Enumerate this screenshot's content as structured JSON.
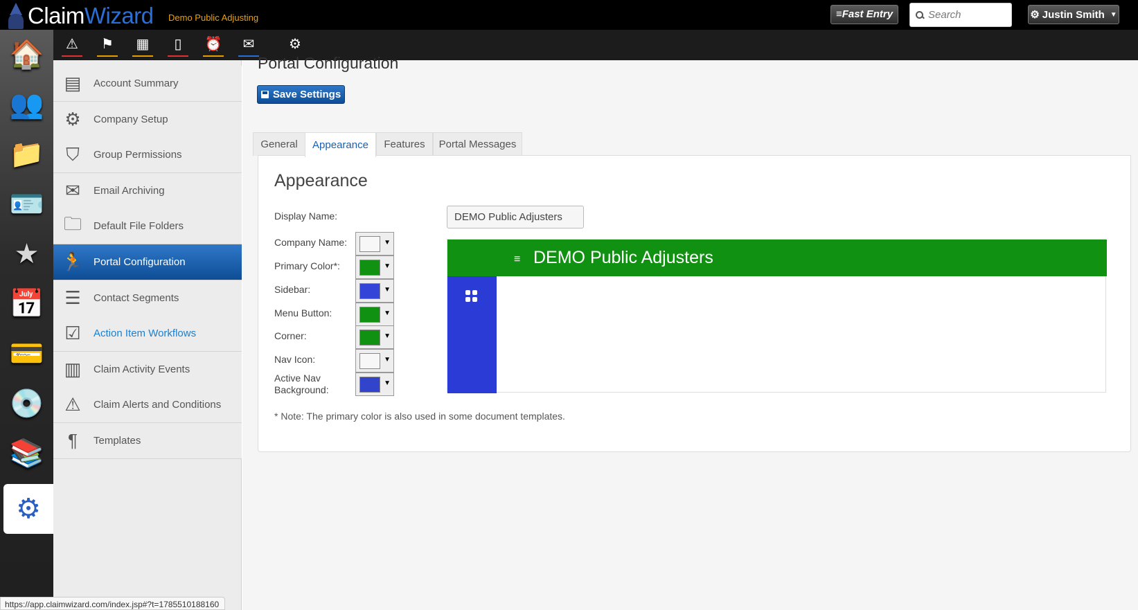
{
  "app": {
    "logo_text_a": "Claim",
    "logo_text_b": "Wizard",
    "company": "Demo Public Adjusting",
    "fast_entry_label": "Fast Entry",
    "search_placeholder": "Search",
    "user_name": "Justin Smith"
  },
  "rail": {
    "items": [
      {
        "name": "home-icon",
        "glyph": "🏠"
      },
      {
        "name": "contacts-icon",
        "glyph": "👥"
      },
      {
        "name": "folder-icon",
        "glyph": "📁"
      },
      {
        "name": "id-card-icon",
        "glyph": "🪪"
      },
      {
        "name": "star-icon",
        "glyph": "★"
      },
      {
        "name": "calendar-icon",
        "glyph": "📅"
      },
      {
        "name": "credit-card-icon",
        "glyph": "💳"
      },
      {
        "name": "disk-icon",
        "glyph": "💿"
      },
      {
        "name": "books-icon",
        "glyph": "📚"
      },
      {
        "name": "settings-gears-icon",
        "glyph": "⚙"
      }
    ]
  },
  "toolbar": {
    "icons": [
      {
        "name": "alert-icon",
        "glyph": "⚠",
        "underline": "#d33"
      },
      {
        "name": "flag-icon",
        "glyph": "⚑",
        "underline": "#e8a000"
      },
      {
        "name": "calendar-small-icon",
        "glyph": "▦",
        "underline": "#e8a000"
      },
      {
        "name": "document-icon",
        "glyph": "▯",
        "underline": "#d33"
      },
      {
        "name": "alarm-icon",
        "glyph": "⏰",
        "underline": "#e8a000"
      },
      {
        "name": "mail-icon",
        "glyph": "✉",
        "underline": "#2a6fd6"
      },
      {
        "name": "gear-icon",
        "glyph": "⚙",
        "underline": ""
      }
    ]
  },
  "side_menu": {
    "items": [
      {
        "label": "Account Summary",
        "icon": "account-summary-icon",
        "glyph": "▤",
        "state": "normal"
      },
      {
        "label": "Company Setup",
        "icon": "company-setup-icon",
        "glyph": "⚙",
        "state": "normal"
      },
      {
        "label": "Group Permissions",
        "icon": "shield-icon",
        "glyph": "⛉",
        "state": "normal"
      },
      {
        "label": "Email Archiving",
        "icon": "email-archive-icon",
        "glyph": "✉",
        "state": "normal"
      },
      {
        "label": "Default File Folders",
        "icon": "folder-tree-icon",
        "glyph": "🗀",
        "state": "normal"
      },
      {
        "label": "Portal Configuration",
        "icon": "portal-icon",
        "glyph": "🏃",
        "state": "active"
      },
      {
        "label": "Contact Segments",
        "icon": "segments-icon",
        "glyph": "☰",
        "state": "normal"
      },
      {
        "label": "Action Item Workflows",
        "icon": "checklist-icon",
        "glyph": "☑",
        "state": "link"
      },
      {
        "label": "Claim Activity Events",
        "icon": "library-icon",
        "glyph": "▥",
        "state": "normal"
      },
      {
        "label": "Claim Alerts and Conditions",
        "icon": "warning-icon",
        "glyph": "⚠",
        "state": "normal"
      },
      {
        "label": "Templates",
        "icon": "paragraph-icon",
        "glyph": "¶",
        "state": "normal"
      }
    ]
  },
  "main": {
    "page_title": "Portal Configuration",
    "save_label": "Save Settings",
    "tabs": [
      {
        "label": "General",
        "active": false
      },
      {
        "label": "Appearance",
        "active": true
      },
      {
        "label": "Features",
        "active": false
      },
      {
        "label": "Portal Messages",
        "active": false
      }
    ],
    "panel_title": "Appearance",
    "display_name_label": "Display Name:",
    "display_name_value": "DEMO Public Adjusters",
    "colors": [
      {
        "label": "Company Name:",
        "color": "#f7f7f7"
      },
      {
        "label": "Primary Color*:",
        "color": "#119111"
      },
      {
        "label": "Sidebar:",
        "color": "#3344d8"
      },
      {
        "label": "Menu Button:",
        "color": "#119111"
      },
      {
        "label": "Corner:",
        "color": "#119111"
      },
      {
        "label": "Nav Icon:",
        "color": "#f7f7f7"
      },
      {
        "label": "Active Nav Background:",
        "color": "#3344cc"
      }
    ],
    "note": "* Note: The primary color is also used in some document templates.",
    "preview": {
      "title": "DEMO Public Adjusters",
      "menu_glyph": "≡",
      "header_color": "#119111",
      "sidebar_color": "#2b3bd6",
      "nav_icon_color": "#ffffff"
    }
  },
  "status_bar": {
    "url": "https://app.claimwizard.com/index.jsp#?t=1785510188160"
  }
}
